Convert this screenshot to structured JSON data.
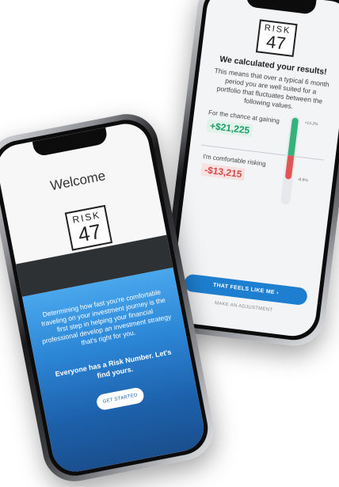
{
  "results_screen": {
    "sign_word": "RISK",
    "sign_number": "47",
    "title": "We calculated your results!",
    "description": "This means that over a typical 6 month period you are well suited for a portfolio that fluctuates between the following values.",
    "gain_label": "For the chance at gaining",
    "gain_value": "+$21,225",
    "gain_percent": "+14.2%",
    "risk_label": "I'm comfortable risking",
    "risk_value": "-$13,215",
    "risk_percent": "-8.6%",
    "primary_button": "THAT FEELS LIKE ME  ›",
    "secondary_link": "MAKE AN ADJUSTMENT",
    "colors": {
      "gain": "#34b27c",
      "loss": "#e05656",
      "accent": "#1e7fd0"
    }
  },
  "welcome_screen": {
    "title": "Welcome",
    "sign_word": "RISK",
    "sign_number": "47",
    "body": "Determining how fast you're comfortable traveling on your investment journey is the first step in helping your financial professional develop an investment strategy that's right for you.",
    "highlight": "Everyone has a Risk Number. Let's find yours.",
    "button": "GET STARTED",
    "colors": {
      "road": "#2e3134",
      "water_top": "#49a7ec",
      "water_bottom": "#1a4f8d"
    }
  }
}
